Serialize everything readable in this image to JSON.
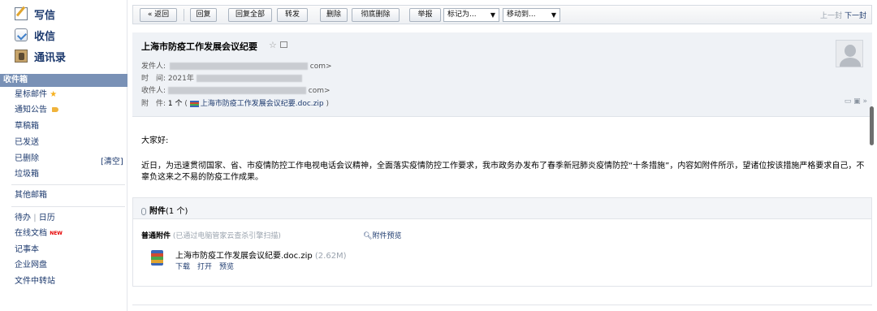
{
  "sidebar": {
    "write": "写信",
    "inbox": "收信",
    "contacts": "通讯录",
    "folders": {
      "inbox": "收件箱",
      "starred": "星标邮件",
      "notices": "通知公告",
      "drafts": "草稿箱",
      "sent": "已发送",
      "deleted": "已删除",
      "clear": "[清空]",
      "spam": "垃圾箱",
      "other": "其他邮箱",
      "todo": "待办",
      "todo_sep": "|",
      "calendar": "日历",
      "docs": "在线文档",
      "docs_badge": "NEW",
      "notes": "记事本",
      "netdisk": "企业网盘",
      "transfer": "文件中转站"
    }
  },
  "toolbar": {
    "back": "« 返回",
    "reply": "回复",
    "reply_all": "回复全部",
    "forward": "转发",
    "delete": "删除",
    "perm_delete": "彻底删除",
    "report": "举报",
    "mark_as": "标记为...",
    "move_to": "移动到...",
    "prev": "上一封",
    "next": "下一封"
  },
  "mail": {
    "subject": "上海市防疫工作发展会议纪要",
    "from_label": "发件人:",
    "from_tail": "com>",
    "time_label": "时　间:",
    "time_value": "2021年",
    "to_label": "收件人:",
    "to_tail": "com>",
    "attach_label": "附　件:",
    "attach_count": "1 个",
    "attach_open": "(",
    "attach_name": "上海市防疫工作发展会议纪要.doc.zip",
    "attach_close": ")",
    "greeting": "大家好:",
    "content": "近日，为迅速贯彻国家、省、市疫情防控工作电视电话会议精神，全面落实疫情防控工作要求，我市政务办发布了春季新冠肺炎疫情防控“十条措施”，内容如附件所示，望诸位按该措施严格要求自己，不辜负这来之不易的防疫工作成果。"
  },
  "attachments": {
    "title": "附件",
    "count": "(1 个)",
    "normal_label": "普通附件",
    "scan_note": "(已通过电脑管家云查杀引擎扫描)",
    "preview_all": "附件预览",
    "file_name": "上海市防疫工作发展会议纪要.doc.zip",
    "file_size": "(2.62M)",
    "download": "下载",
    "open": "打开",
    "preview": "预览"
  },
  "colors": {
    "selected_folder_bg": "#7991b6",
    "link": "#1d3a6e",
    "header_bg": "#eff2f6"
  }
}
